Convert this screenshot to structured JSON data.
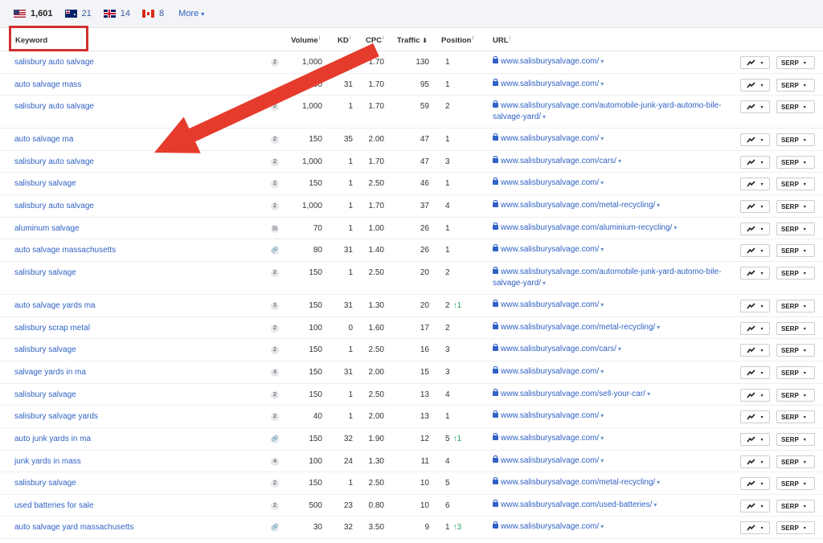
{
  "countries": [
    {
      "flag": "us-flag-icon",
      "count": "1,601"
    },
    {
      "flag": "au-flag-icon",
      "count": "21"
    },
    {
      "flag": "gb-flag-icon",
      "count": "14"
    },
    {
      "flag": "ca-flag-icon",
      "count": "8"
    }
  ],
  "more_label": "More",
  "more_caret": "▾",
  "headers": {
    "keyword": "Keyword",
    "volume": "Volume",
    "kd": "KD",
    "cpc": "CPC",
    "traffic": "Traffic",
    "traffic_sort": "⬇",
    "position": "Position",
    "url": "URL",
    "info": "i"
  },
  "buttons": {
    "serp": "SERP",
    "caret": "▾",
    "trend_icon": "trend-chart-icon"
  },
  "colors": {
    "link": "#2f62c4",
    "highlight_box": "#d32f2f",
    "arrow": "#e53b2c",
    "position_up": "#2aa35a"
  },
  "rows": [
    {
      "keyword": "salisbury auto salvage",
      "serp": "2",
      "volume": "1,000",
      "kd": "1",
      "cpc": "1.70",
      "traffic": "130",
      "position": "1",
      "change": "",
      "url": "www.salisburysalvage.com/"
    },
    {
      "keyword": "auto salvage mass",
      "serp": "",
      "volume": "500",
      "kd": "31",
      "cpc": "1.70",
      "traffic": "95",
      "position": "1",
      "change": "",
      "url": "www.salisburysalvage.com/"
    },
    {
      "keyword": "salisbury auto salvage",
      "serp": "2",
      "volume": "1,000",
      "kd": "1",
      "cpc": "1.70",
      "traffic": "59",
      "position": "2",
      "change": "",
      "url": "www.salisburysalvage.com/automobile-junk-yard-automo-bile-salvage-yard/"
    },
    {
      "keyword": "auto salvage ma",
      "serp": "2",
      "volume": "150",
      "kd": "35",
      "cpc": "2.00",
      "traffic": "47",
      "position": "1",
      "change": "",
      "url": "www.salisburysalvage.com/"
    },
    {
      "keyword": "salisbury auto salvage",
      "serp": "2",
      "volume": "1,000",
      "kd": "1",
      "cpc": "1.70",
      "traffic": "47",
      "position": "3",
      "change": "",
      "url": "www.salisburysalvage.com/cars/"
    },
    {
      "keyword": "salisbury salvage",
      "serp": "2",
      "volume": "150",
      "kd": "1",
      "cpc": "2.50",
      "traffic": "46",
      "position": "1",
      "change": "",
      "url": "www.salisburysalvage.com/"
    },
    {
      "keyword": "salisbury auto salvage",
      "serp": "2",
      "volume": "1,000",
      "kd": "1",
      "cpc": "1.70",
      "traffic": "37",
      "position": "4",
      "change": "",
      "url": "www.salisburysalvage.com/metal-recycling/"
    },
    {
      "keyword": "aluminum salvage",
      "serp": "▤",
      "volume": "70",
      "kd": "1",
      "cpc": "1.00",
      "traffic": "26",
      "position": "1",
      "change": "",
      "url": "www.salisburysalvage.com/aluminium-recycling/"
    },
    {
      "keyword": "auto salvage massachusetts",
      "serp": "🔗",
      "volume": "80",
      "kd": "31",
      "cpc": "1.40",
      "traffic": "26",
      "position": "1",
      "change": "",
      "url": "www.salisburysalvage.com/"
    },
    {
      "keyword": "salisbury salvage",
      "serp": "2",
      "volume": "150",
      "kd": "1",
      "cpc": "2.50",
      "traffic": "20",
      "position": "2",
      "change": "",
      "url": "www.salisburysalvage.com/automobile-junk-yard-automo-bile-salvage-yard/"
    },
    {
      "keyword": "auto salvage yards ma",
      "serp": "3",
      "volume": "150",
      "kd": "31",
      "cpc": "1.30",
      "traffic": "20",
      "position": "2",
      "change": "↑1",
      "url": "www.salisburysalvage.com/"
    },
    {
      "keyword": "salisbury scrap metal",
      "serp": "2",
      "volume": "100",
      "kd": "0",
      "cpc": "1.60",
      "traffic": "17",
      "position": "2",
      "change": "",
      "url": "www.salisburysalvage.com/metal-recycling/"
    },
    {
      "keyword": "salisbury salvage",
      "serp": "2",
      "volume": "150",
      "kd": "1",
      "cpc": "2.50",
      "traffic": "16",
      "position": "3",
      "change": "",
      "url": "www.salisburysalvage.com/cars/"
    },
    {
      "keyword": "salvage yards in ma",
      "serp": "4",
      "volume": "150",
      "kd": "31",
      "cpc": "2.00",
      "traffic": "15",
      "position": "3",
      "change": "",
      "url": "www.salisburysalvage.com/"
    },
    {
      "keyword": "salisbury salvage",
      "serp": "2",
      "volume": "150",
      "kd": "1",
      "cpc": "2.50",
      "traffic": "13",
      "position": "4",
      "change": "",
      "url": "www.salisburysalvage.com/sell-your-car/"
    },
    {
      "keyword": "salisbury salvage yards",
      "serp": "2",
      "volume": "40",
      "kd": "1",
      "cpc": "2.00",
      "traffic": "13",
      "position": "1",
      "change": "",
      "url": "www.salisburysalvage.com/"
    },
    {
      "keyword": "auto junk yards in ma",
      "serp": "🔗",
      "volume": "150",
      "kd": "32",
      "cpc": "1.90",
      "traffic": "12",
      "position": "5",
      "change": "↑1",
      "url": "www.salisburysalvage.com/"
    },
    {
      "keyword": "junk yards in mass",
      "serp": "4",
      "volume": "100",
      "kd": "24",
      "cpc": "1.30",
      "traffic": "11",
      "position": "4",
      "change": "",
      "url": "www.salisburysalvage.com/"
    },
    {
      "keyword": "salisbury salvage",
      "serp": "2",
      "volume": "150",
      "kd": "1",
      "cpc": "2.50",
      "traffic": "10",
      "position": "5",
      "change": "",
      "url": "www.salisburysalvage.com/metal-recycling/"
    },
    {
      "keyword": "used batteries for sale",
      "serp": "2",
      "volume": "500",
      "kd": "23",
      "cpc": "0.80",
      "traffic": "10",
      "position": "6",
      "change": "",
      "url": "www.salisburysalvage.com/used-batteries/"
    },
    {
      "keyword": "auto salvage yard massachusetts",
      "serp": "🔗",
      "volume": "30",
      "kd": "32",
      "cpc": "3.50",
      "traffic": "9",
      "position": "1",
      "change": "↑3",
      "url": "www.salisburysalvage.com/"
    }
  ]
}
